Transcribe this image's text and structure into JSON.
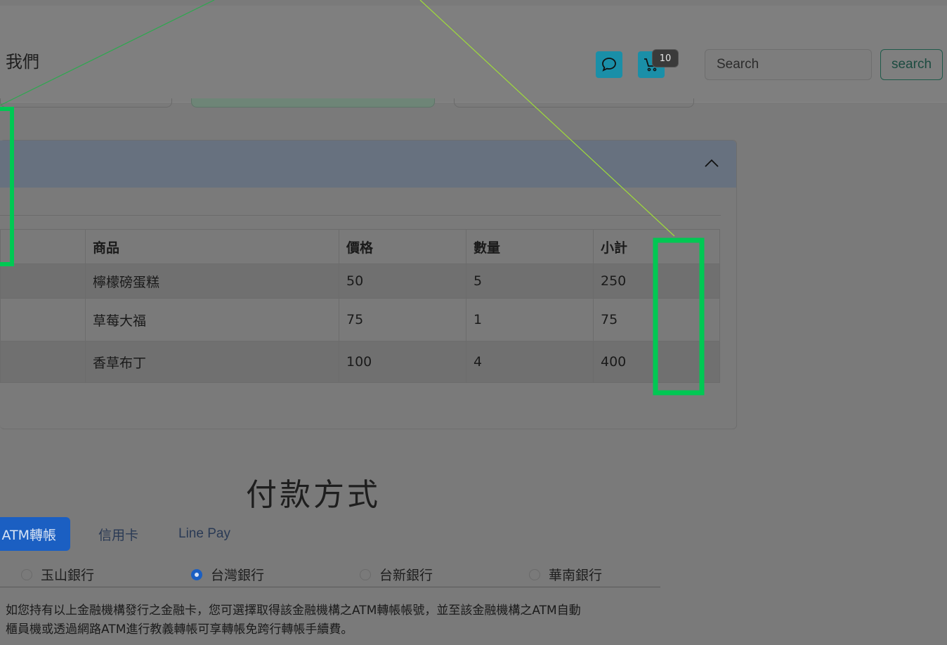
{
  "navbar": {
    "brand_fragment": "我們",
    "cart_count": "10",
    "search_placeholder": "Search",
    "search_button": "search"
  },
  "order": {
    "headers": [
      "",
      "商品",
      "價格",
      "數量",
      "小計"
    ],
    "rows": [
      {
        "name": "檸檬磅蛋糕",
        "price": "50",
        "qty": "5",
        "subtotal": "250"
      },
      {
        "name": "草莓大福",
        "price": "75",
        "qty": "1",
        "subtotal": "75"
      },
      {
        "name": "香草布丁",
        "price": "100",
        "qty": "4",
        "subtotal": "400"
      }
    ]
  },
  "payment": {
    "title": "付款方式",
    "tabs": [
      "ATM轉帳",
      "信用卡",
      "Line Pay"
    ],
    "banks": [
      "玉山銀行",
      "台灣銀行",
      "台新銀行",
      "華南銀行"
    ],
    "selected_bank": "台灣銀行",
    "note_line1": "如您持有以上金融機構發行之金融卡，您可選擇取得該金融機構之ATM轉帳帳號，並至該金融機構之ATM自動",
    "note_line2": "櫃員機或透過網路ATM進行教義轉帳可享轉帳免跨行轉帳手續費。"
  },
  "colors": {
    "accent_blue": "#1b5fc2",
    "icon_teal": "#1a8fa8",
    "annotation_green": "#00c853"
  },
  "icons": [
    "chat-bubble-icon",
    "cart-icon",
    "chevron-up-icon"
  ]
}
